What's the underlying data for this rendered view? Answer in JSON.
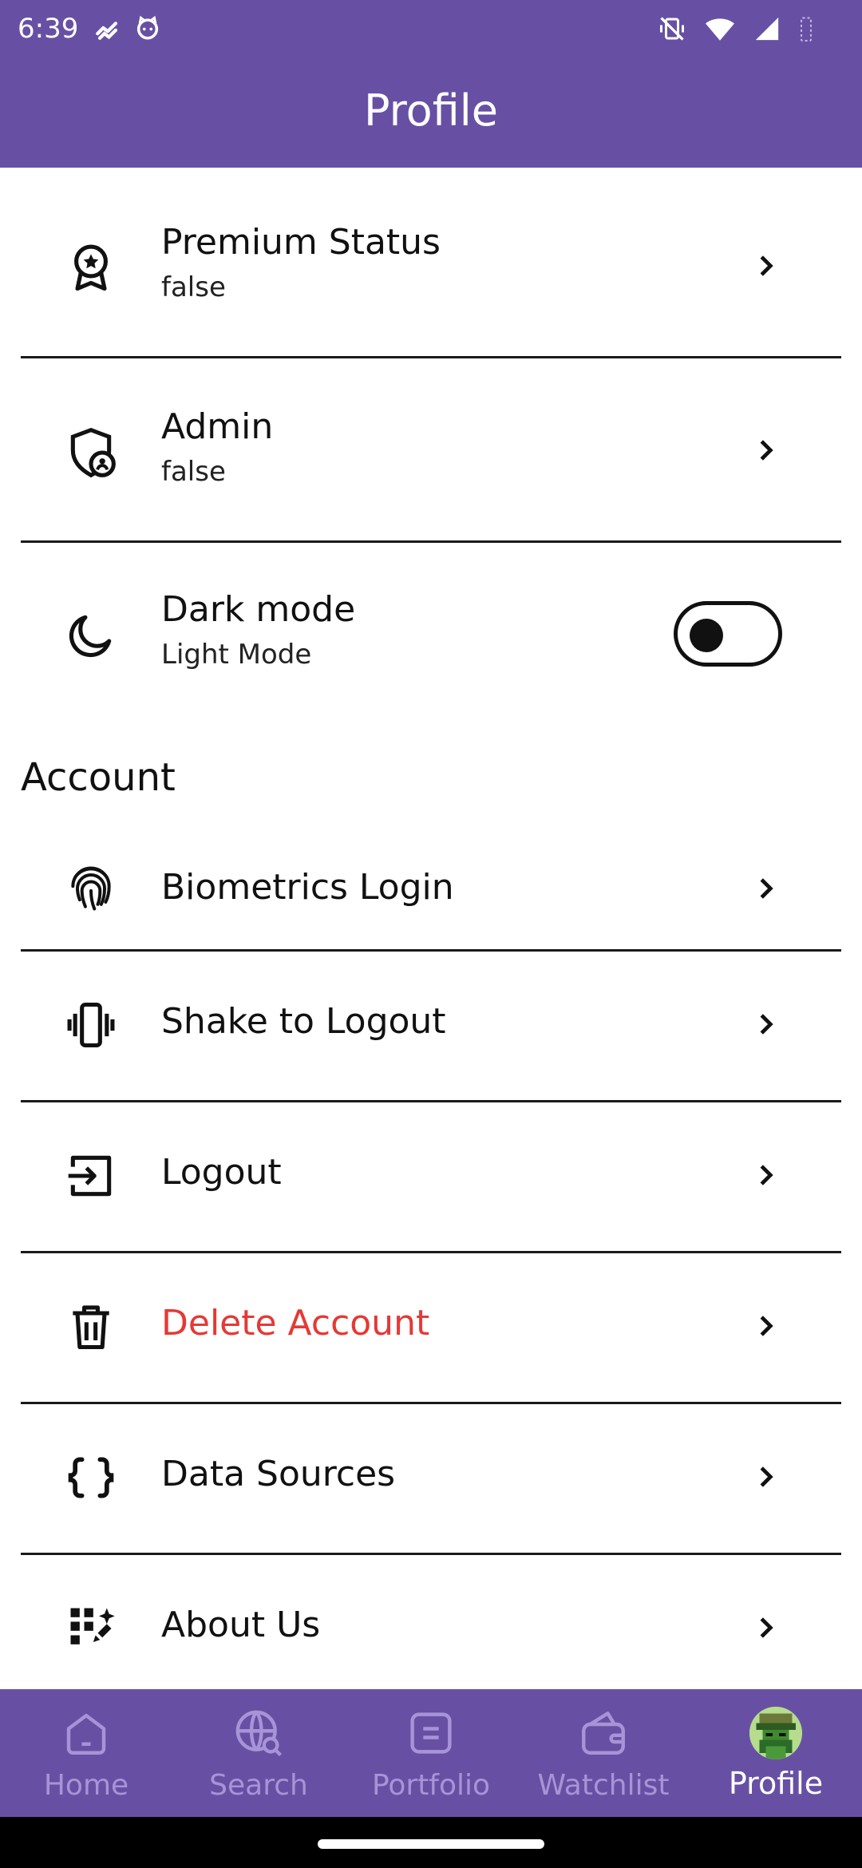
{
  "status_bar": {
    "time": "6:39",
    "left_icons": [
      "trend-icon",
      "cat-icon"
    ],
    "right_icons": [
      "vibrate-off-icon",
      "wifi-icon",
      "signal-icon",
      "battery-icon"
    ]
  },
  "app_bar": {
    "title": "Profile"
  },
  "profile_items": [
    {
      "title": "Premium Status",
      "subtitle": "false",
      "icon": "award-icon"
    },
    {
      "title": "Admin",
      "subtitle": "false",
      "icon": "shield-user-icon"
    },
    {
      "title": "Dark mode",
      "subtitle": "Light Mode",
      "icon": "moon-icon",
      "toggle_on": false
    }
  ],
  "account": {
    "header": "Account",
    "items": [
      {
        "title": "Biometrics Login",
        "icon": "fingerprint-icon"
      },
      {
        "title": "Shake to Logout",
        "icon": "vibrate-icon"
      },
      {
        "title": "Logout",
        "icon": "logout-icon"
      },
      {
        "title": "Delete Account",
        "icon": "trash-icon",
        "color": "#e53935"
      },
      {
        "title": "Data Sources",
        "icon": "braces-icon"
      },
      {
        "title": "About Us",
        "icon": "sparkle-grid-icon"
      }
    ]
  },
  "bottom_nav": {
    "items": [
      {
        "label": "Home",
        "icon": "home-icon"
      },
      {
        "label": "Search",
        "icon": "globe-search-icon"
      },
      {
        "label": "Portfolio",
        "icon": "portfolio-icon"
      },
      {
        "label": "Watchlist",
        "icon": "wallet-icon"
      },
      {
        "label": "Profile",
        "icon": "avatar",
        "active": true
      }
    ]
  },
  "colors": {
    "primary": "#6750a4",
    "nav_inactive": "#a794d6",
    "danger": "#e53935"
  }
}
